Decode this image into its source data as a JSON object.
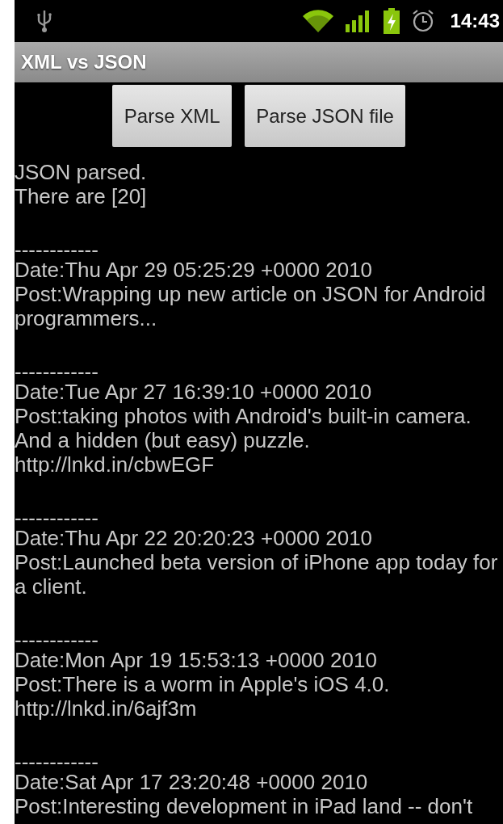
{
  "status_bar": {
    "time": "14:43"
  },
  "window": {
    "title": "XML vs JSON"
  },
  "buttons": [
    {
      "label": "Parse XML"
    },
    {
      "label": "Parse JSON file"
    }
  ],
  "output": {
    "status_lines": [
      "JSON parsed.",
      "There are [20]"
    ],
    "posts": [
      {
        "separator": "------------",
        "date": "Date:Thu Apr 29 05:25:29 +0000 2010",
        "post": "Post:Wrapping up new article on JSON for Android programmers..."
      },
      {
        "separator": "------------",
        "date": "Date:Tue Apr 27 16:39:10 +0000 2010",
        "post": "Post:taking photos with Android's built-in camera. And a hidden (but easy) puzzle.  http://lnkd.in/cbwEGF"
      },
      {
        "separator": "------------",
        "date": "Date:Thu Apr 22 20:20:23 +0000 2010",
        "post": "Post:Launched beta version of iPhone app today for a client."
      },
      {
        "separator": "------------",
        "date": "Date:Mon Apr 19 15:53:13 +0000 2010",
        "post": "Post:There is a worm in Apple's iOS 4.0.  http://lnkd.in/6ajf3m"
      },
      {
        "separator": "------------",
        "date": "Date:Sat Apr 17 23:20:48 +0000 2010",
        "post": "Post:Interesting development in iPad land -- don't"
      }
    ]
  }
}
